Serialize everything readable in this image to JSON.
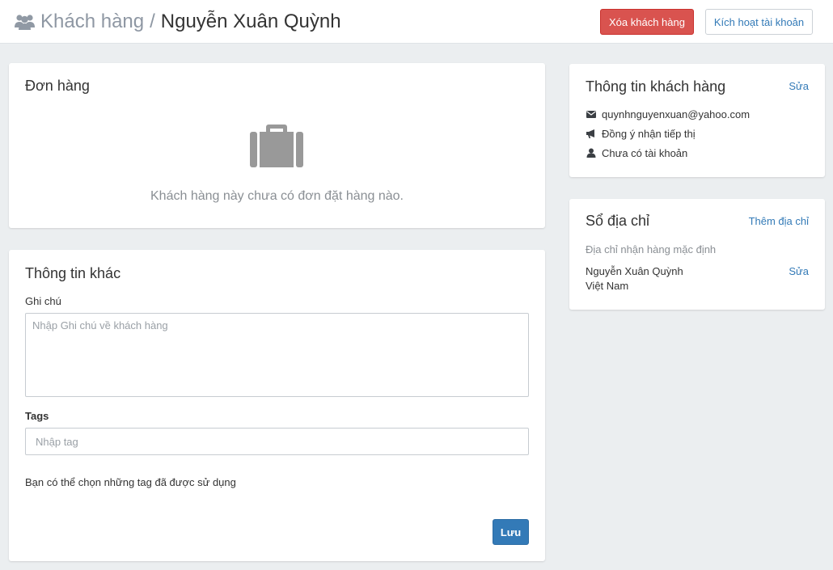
{
  "header": {
    "breadcrumb_parent": "Khách hàng",
    "breadcrumb_separator": "/",
    "customer_name": "Nguyễn Xuân Quỳnh",
    "delete_button": "Xóa khách hàng",
    "activate_button": "Kích hoạt tài khoản"
  },
  "orders": {
    "title": "Đơn hàng",
    "empty_message": "Khách hàng này chưa có đơn đặt hàng nào."
  },
  "other_info": {
    "title": "Thông tin khác",
    "note_label": "Ghi chú",
    "note_placeholder": "Nhập Ghi chú về khách hàng",
    "note_value": "",
    "tags_label": "Tags",
    "tags_placeholder": "Nhập tag",
    "tags_value": "",
    "tags_hint": "Bạn có thể chọn những tag đã được sử dụng",
    "save_button": "Lưu"
  },
  "customer_info": {
    "title": "Thông tin khách hàng",
    "edit_link": "Sửa",
    "email": "quynhnguyenxuan@yahoo.com",
    "marketing": "Đồng ý nhận tiếp thị",
    "account_status": "Chưa có tài khoản"
  },
  "address_book": {
    "title": "Sổ địa chỉ",
    "add_link": "Thêm địa chỉ",
    "default_label": "Địa chỉ nhận hàng mặc định",
    "name": "Nguyễn Xuân Quỳnh",
    "country": "Việt Nam",
    "edit_link": "Sửa"
  },
  "colors": {
    "danger": "#d9534f",
    "primary": "#337ab7",
    "background": "#ebeef0",
    "muted_text": "#8a8f94"
  },
  "icons": [
    "users-icon",
    "briefcase-icon",
    "envelope-icon",
    "bullhorn-icon",
    "user-icon"
  ]
}
